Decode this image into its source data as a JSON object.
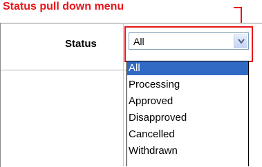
{
  "annotation": {
    "text": "Status pull down menu"
  },
  "form": {
    "status_label": "Status",
    "status_select": {
      "value": "All",
      "options": [
        "All",
        "Processing",
        "Approved",
        "Disapproved",
        "Cancelled",
        "Withdrawn"
      ],
      "selected_index": 0
    }
  },
  "colors": {
    "annotation": "#e8141a",
    "selected_option_bg": "#316ac5",
    "select_border": "#7f9db9"
  },
  "icons": {
    "select_arrow": "chevron-down-icon"
  }
}
